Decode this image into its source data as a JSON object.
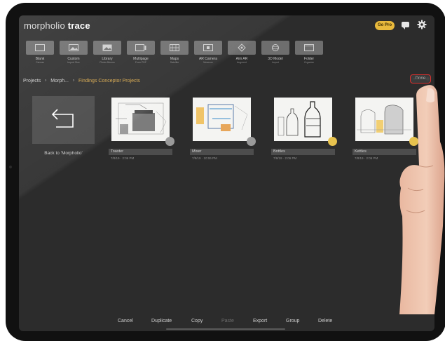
{
  "app": {
    "logo_light": "morpholio",
    "logo_bold": "trace",
    "go_pro_label": "Go Pro"
  },
  "toolbar": {
    "items": [
      {
        "label": "Blank",
        "sub": "Canvas"
      },
      {
        "label": "Custom",
        "sub": "Import Size"
      },
      {
        "label": "Library",
        "sub": "Photo Albums"
      },
      {
        "label": "Multipage",
        "sub": "From PDF"
      },
      {
        "label": "Maps",
        "sub": "Satellite"
      },
      {
        "label": "AR Camera",
        "sub": "Measure"
      },
      {
        "label": "Aim AR",
        "sub": "Augment"
      },
      {
        "label": "3D Model",
        "sub": "Import"
      },
      {
        "label": "Folder",
        "sub": "Organize"
      }
    ]
  },
  "breadcrumb": {
    "root": "Projects",
    "middle": "Morph...",
    "current": "Findings Conceptor Projects",
    "sep": "›"
  },
  "done_label": "Done",
  "back": {
    "label": "Back to 'Morpholio'"
  },
  "projects": [
    {
      "name": "Toaster",
      "date": "7/8/19 · 2:06 PM",
      "dot_color": "#9a9a9a"
    },
    {
      "name": "Mixer",
      "date": "7/8/19 · 10:06 PM",
      "dot_color": "#9a9a9a"
    },
    {
      "name": "Bottles",
      "date": "7/8/19 · 2:06 PM",
      "dot_color": "#e7c24e"
    },
    {
      "name": "Kettles",
      "date": "7/8/19 · 2:06 PM",
      "dot_color": "#e7c24e"
    }
  ],
  "actions": {
    "cancel": "Cancel",
    "duplicate": "Duplicate",
    "copy": "Copy",
    "paste": "Paste",
    "export": "Export",
    "group": "Group",
    "delete": "Delete"
  },
  "icons": {
    "chat": "chat-icon",
    "settings": "gear-icon",
    "back": "back-arrow-icon"
  },
  "colors": {
    "screen_bg": "#2c2c2c",
    "accent_gold": "#e8b93c",
    "breadcrumb_current": "#d9a84a",
    "done_highlight": "#d8302e"
  }
}
